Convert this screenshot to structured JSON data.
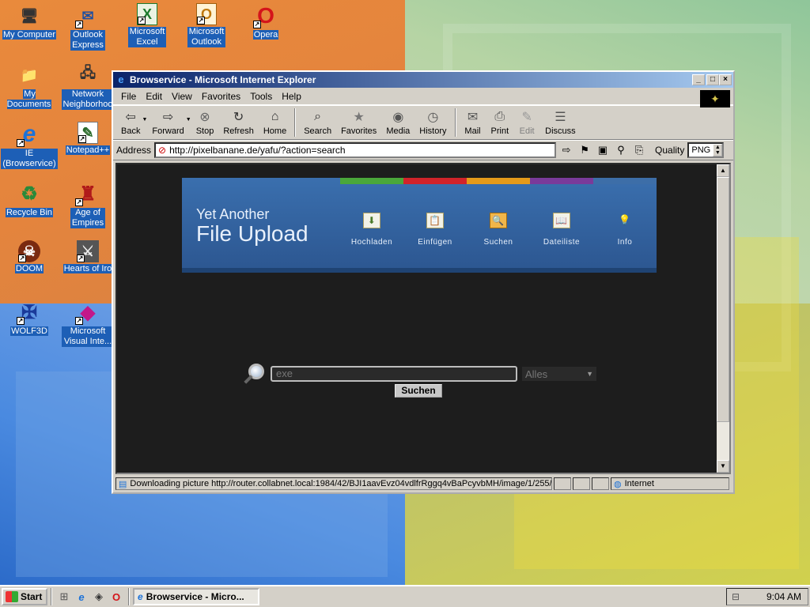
{
  "desktop": {
    "icons": [
      {
        "label": "My Computer",
        "glyph": "🖥"
      },
      {
        "label": "Outlook Express",
        "glyph": "✉"
      },
      {
        "label": "Microsoft Excel",
        "glyph": "X"
      },
      {
        "label": "Microsoft Outlook",
        "glyph": "O"
      },
      {
        "label": "Opera",
        "glyph": "O"
      },
      {
        "label": "My Documents",
        "glyph": "📁"
      },
      {
        "label": "Network Neighborhoo",
        "glyph": "🖧"
      },
      {
        "label": "IE (Browservice)",
        "glyph": "e"
      },
      {
        "label": "Notepad++",
        "glyph": "✎"
      },
      {
        "label": "Recycle Bin",
        "glyph": "♻"
      },
      {
        "label": "Age of Empires",
        "glyph": "♜"
      },
      {
        "label": "DOOM",
        "glyph": "☠"
      },
      {
        "label": "Hearts of Iro",
        "glyph": "⚔"
      },
      {
        "label": "WOLF3D",
        "glyph": "✠"
      },
      {
        "label": "Microsoft Visual Inte...",
        "glyph": "◆"
      }
    ]
  },
  "window": {
    "title": "Browservice - Microsoft Internet Explorer",
    "menu": [
      "File",
      "Edit",
      "View",
      "Favorites",
      "Tools",
      "Help"
    ],
    "toolbar": {
      "back": "Back",
      "forward": "Forward",
      "stop": "Stop",
      "refresh": "Refresh",
      "home": "Home",
      "search": "Search",
      "favorites": "Favorites",
      "media": "Media",
      "history": "History",
      "mail": "Mail",
      "print": "Print",
      "edit": "Edit",
      "discuss": "Discuss"
    },
    "address": {
      "label": "Address",
      "url": "http://pixelbanane.de/yafu/?action=search",
      "quality_label": "Quality",
      "quality_value": "PNG"
    },
    "status": {
      "text": "Downloading picture http://router.collabnet.local:1984/42/BJI1aavEvz04vdlfrRggq4vBaPcyvbMH/image/1/255/",
      "zone": "Internet"
    }
  },
  "page": {
    "logo_line1": "Yet Another",
    "logo_line2": "File Upload",
    "stripe_colors": [
      "#4aa73a",
      "#d1232a",
      "#e59a1a",
      "#7a3a9a",
      "#3d6ea8"
    ],
    "nav": [
      {
        "label": "Hochladen",
        "glyph": "⬇"
      },
      {
        "label": "Einfügen",
        "glyph": "📋"
      },
      {
        "label": "Suchen",
        "glyph": "🔍"
      },
      {
        "label": "Dateiliste",
        "glyph": "📖"
      },
      {
        "label": "Info",
        "glyph": "💡"
      }
    ],
    "search": {
      "value": "exe",
      "scope": "Alles",
      "button": "Suchen"
    }
  },
  "taskbar": {
    "start": "Start",
    "task_ie": "Browservice - Micro...",
    "clock": "9:04 AM"
  }
}
